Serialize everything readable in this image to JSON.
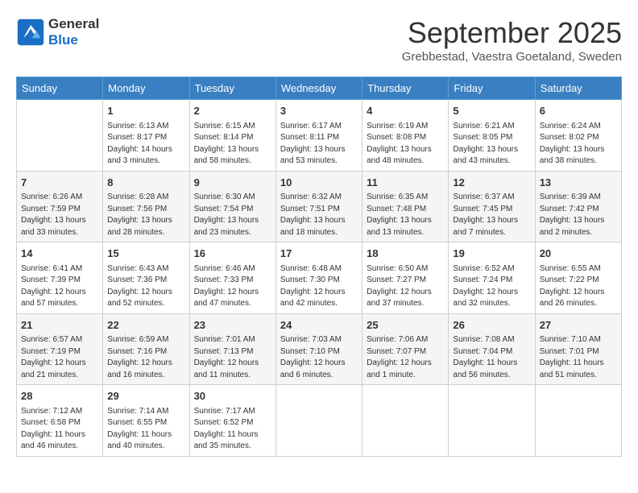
{
  "header": {
    "logo_line1": "General",
    "logo_line2": "Blue",
    "month": "September 2025",
    "location": "Grebbestad, Vaestra Goetaland, Sweden"
  },
  "weekdays": [
    "Sunday",
    "Monday",
    "Tuesday",
    "Wednesday",
    "Thursday",
    "Friday",
    "Saturday"
  ],
  "weeks": [
    [
      {
        "day": "",
        "sunrise": "",
        "sunset": "",
        "daylight": ""
      },
      {
        "day": "1",
        "sunrise": "Sunrise: 6:13 AM",
        "sunset": "Sunset: 8:17 PM",
        "daylight": "Daylight: 14 hours and 3 minutes."
      },
      {
        "day": "2",
        "sunrise": "Sunrise: 6:15 AM",
        "sunset": "Sunset: 8:14 PM",
        "daylight": "Daylight: 13 hours and 58 minutes."
      },
      {
        "day": "3",
        "sunrise": "Sunrise: 6:17 AM",
        "sunset": "Sunset: 8:11 PM",
        "daylight": "Daylight: 13 hours and 53 minutes."
      },
      {
        "day": "4",
        "sunrise": "Sunrise: 6:19 AM",
        "sunset": "Sunset: 8:08 PM",
        "daylight": "Daylight: 13 hours and 48 minutes."
      },
      {
        "day": "5",
        "sunrise": "Sunrise: 6:21 AM",
        "sunset": "Sunset: 8:05 PM",
        "daylight": "Daylight: 13 hours and 43 minutes."
      },
      {
        "day": "6",
        "sunrise": "Sunrise: 6:24 AM",
        "sunset": "Sunset: 8:02 PM",
        "daylight": "Daylight: 13 hours and 38 minutes."
      }
    ],
    [
      {
        "day": "7",
        "sunrise": "Sunrise: 6:26 AM",
        "sunset": "Sunset: 7:59 PM",
        "daylight": "Daylight: 13 hours and 33 minutes."
      },
      {
        "day": "8",
        "sunrise": "Sunrise: 6:28 AM",
        "sunset": "Sunset: 7:56 PM",
        "daylight": "Daylight: 13 hours and 28 minutes."
      },
      {
        "day": "9",
        "sunrise": "Sunrise: 6:30 AM",
        "sunset": "Sunset: 7:54 PM",
        "daylight": "Daylight: 13 hours and 23 minutes."
      },
      {
        "day": "10",
        "sunrise": "Sunrise: 6:32 AM",
        "sunset": "Sunset: 7:51 PM",
        "daylight": "Daylight: 13 hours and 18 minutes."
      },
      {
        "day": "11",
        "sunrise": "Sunrise: 6:35 AM",
        "sunset": "Sunset: 7:48 PM",
        "daylight": "Daylight: 13 hours and 13 minutes."
      },
      {
        "day": "12",
        "sunrise": "Sunrise: 6:37 AM",
        "sunset": "Sunset: 7:45 PM",
        "daylight": "Daylight: 13 hours and 7 minutes."
      },
      {
        "day": "13",
        "sunrise": "Sunrise: 6:39 AM",
        "sunset": "Sunset: 7:42 PM",
        "daylight": "Daylight: 13 hours and 2 minutes."
      }
    ],
    [
      {
        "day": "14",
        "sunrise": "Sunrise: 6:41 AM",
        "sunset": "Sunset: 7:39 PM",
        "daylight": "Daylight: 12 hours and 57 minutes."
      },
      {
        "day": "15",
        "sunrise": "Sunrise: 6:43 AM",
        "sunset": "Sunset: 7:36 PM",
        "daylight": "Daylight: 12 hours and 52 minutes."
      },
      {
        "day": "16",
        "sunrise": "Sunrise: 6:46 AM",
        "sunset": "Sunset: 7:33 PM",
        "daylight": "Daylight: 12 hours and 47 minutes."
      },
      {
        "day": "17",
        "sunrise": "Sunrise: 6:48 AM",
        "sunset": "Sunset: 7:30 PM",
        "daylight": "Daylight: 12 hours and 42 minutes."
      },
      {
        "day": "18",
        "sunrise": "Sunrise: 6:50 AM",
        "sunset": "Sunset: 7:27 PM",
        "daylight": "Daylight: 12 hours and 37 minutes."
      },
      {
        "day": "19",
        "sunrise": "Sunrise: 6:52 AM",
        "sunset": "Sunset: 7:24 PM",
        "daylight": "Daylight: 12 hours and 32 minutes."
      },
      {
        "day": "20",
        "sunrise": "Sunrise: 6:55 AM",
        "sunset": "Sunset: 7:22 PM",
        "daylight": "Daylight: 12 hours and 26 minutes."
      }
    ],
    [
      {
        "day": "21",
        "sunrise": "Sunrise: 6:57 AM",
        "sunset": "Sunset: 7:19 PM",
        "daylight": "Daylight: 12 hours and 21 minutes."
      },
      {
        "day": "22",
        "sunrise": "Sunrise: 6:59 AM",
        "sunset": "Sunset: 7:16 PM",
        "daylight": "Daylight: 12 hours and 16 minutes."
      },
      {
        "day": "23",
        "sunrise": "Sunrise: 7:01 AM",
        "sunset": "Sunset: 7:13 PM",
        "daylight": "Daylight: 12 hours and 11 minutes."
      },
      {
        "day": "24",
        "sunrise": "Sunrise: 7:03 AM",
        "sunset": "Sunset: 7:10 PM",
        "daylight": "Daylight: 12 hours and 6 minutes."
      },
      {
        "day": "25",
        "sunrise": "Sunrise: 7:06 AM",
        "sunset": "Sunset: 7:07 PM",
        "daylight": "Daylight: 12 hours and 1 minute."
      },
      {
        "day": "26",
        "sunrise": "Sunrise: 7:08 AM",
        "sunset": "Sunset: 7:04 PM",
        "daylight": "Daylight: 11 hours and 56 minutes."
      },
      {
        "day": "27",
        "sunrise": "Sunrise: 7:10 AM",
        "sunset": "Sunset: 7:01 PM",
        "daylight": "Daylight: 11 hours and 51 minutes."
      }
    ],
    [
      {
        "day": "28",
        "sunrise": "Sunrise: 7:12 AM",
        "sunset": "Sunset: 6:58 PM",
        "daylight": "Daylight: 11 hours and 46 minutes."
      },
      {
        "day": "29",
        "sunrise": "Sunrise: 7:14 AM",
        "sunset": "Sunset: 6:55 PM",
        "daylight": "Daylight: 11 hours and 40 minutes."
      },
      {
        "day": "30",
        "sunrise": "Sunrise: 7:17 AM",
        "sunset": "Sunset: 6:52 PM",
        "daylight": "Daylight: 11 hours and 35 minutes."
      },
      {
        "day": "",
        "sunrise": "",
        "sunset": "",
        "daylight": ""
      },
      {
        "day": "",
        "sunrise": "",
        "sunset": "",
        "daylight": ""
      },
      {
        "day": "",
        "sunrise": "",
        "sunset": "",
        "daylight": ""
      },
      {
        "day": "",
        "sunrise": "",
        "sunset": "",
        "daylight": ""
      }
    ]
  ]
}
